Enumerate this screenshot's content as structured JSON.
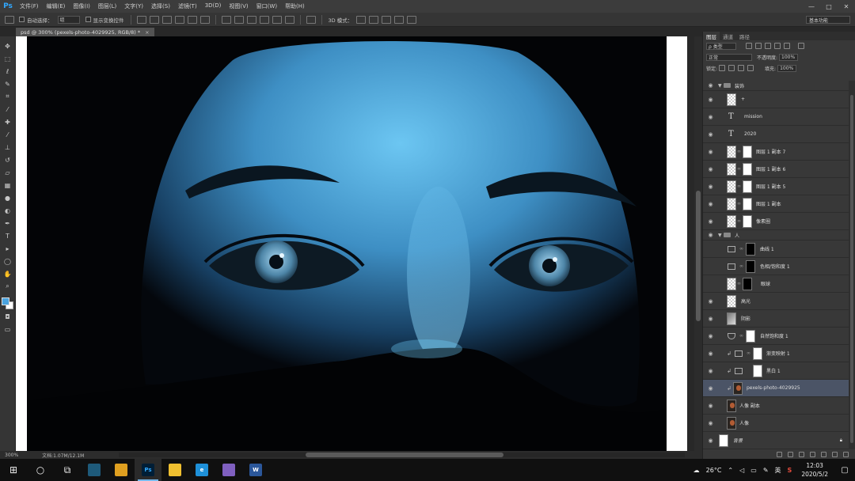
{
  "app": {
    "logo": "Ps"
  },
  "menu": [
    "文件(F)",
    "编辑(E)",
    "图像(I)",
    "图层(L)",
    "文字(Y)",
    "选择(S)",
    "滤镜(T)",
    "3D(D)",
    "视图(V)",
    "窗口(W)",
    "帮助(H)"
  ],
  "window_controls": {
    "minimize": "—",
    "maximize": "□",
    "close": "✕"
  },
  "options": {
    "auto_select_label": "自动选择：",
    "auto_select_value": "组",
    "show_transform_label": "显示变换控件",
    "mode_3d_label": "3D 模式：",
    "workspace": "基本功能"
  },
  "document": {
    "tab_title": "psd @ 300% (pexels-photo-4029925, RGB/8) *",
    "tab_close": "×",
    "zoom": "300%",
    "doc_info": "文档:1.07M/12.1M"
  },
  "tools": [
    "move",
    "marquee",
    "lasso",
    "quick-select",
    "crop",
    "eyedropper",
    "healing",
    "brush",
    "stamp",
    "history-brush",
    "eraser",
    "gradient",
    "blur",
    "dodge",
    "pen",
    "type",
    "path-select",
    "shape",
    "hand",
    "zoom"
  ],
  "colors": {
    "foreground": "#4aa3df",
    "background": "#ffffff",
    "selected_layer": "#4b5466",
    "accent": "#31a8ff"
  },
  "layers_panel": {
    "tabs": [
      "图层",
      "通道",
      "路径"
    ],
    "filter_label": "ρ 类型",
    "blend_mode": "正常",
    "opacity_label": "不透明度:",
    "opacity_value": "100%",
    "lock_label": "锁定:",
    "fill_label": "填充:",
    "fill_value": "100%",
    "layers": [
      {
        "name": "装饰",
        "kind": "group",
        "visible": true
      },
      {
        "name": "+",
        "kind": "pixel",
        "visible": true,
        "indent": 1
      },
      {
        "name": "mission",
        "kind": "text",
        "visible": true,
        "indent": 1
      },
      {
        "name": "2020",
        "kind": "text",
        "visible": true,
        "indent": 1
      },
      {
        "name": "图层 1 副本 7",
        "kind": "masked",
        "visible": true,
        "indent": 1
      },
      {
        "name": "图层 1 副本 6",
        "kind": "masked",
        "visible": true,
        "indent": 1
      },
      {
        "name": "图层 1 副本 5",
        "kind": "masked",
        "visible": true,
        "indent": 1
      },
      {
        "name": "图层 1 副本",
        "kind": "masked",
        "visible": true,
        "indent": 1
      },
      {
        "name": "像素圈",
        "kind": "masked",
        "visible": true,
        "indent": 1
      },
      {
        "name": "人",
        "kind": "group",
        "visible": true
      },
      {
        "name": "曲线 1",
        "kind": "adjust-black",
        "visible": false,
        "indent": 1
      },
      {
        "name": "色相/饱和度 1",
        "kind": "adjust-black",
        "visible": false,
        "indent": 1
      },
      {
        "name": "眼球",
        "kind": "masked-dark",
        "visible": false,
        "indent": 1
      },
      {
        "name": "高光",
        "kind": "pixel",
        "visible": true,
        "indent": 1
      },
      {
        "name": "阴影",
        "kind": "shadow",
        "visible": true,
        "indent": 1
      },
      {
        "name": "自然饱和度 1",
        "kind": "adjust",
        "visible": true,
        "indent": 1
      },
      {
        "name": "渐变映射 1",
        "kind": "adjust-clip",
        "visible": true,
        "indent": 1
      },
      {
        "name": "黑白 1",
        "kind": "adjust-clip-nochain",
        "visible": true,
        "indent": 1
      },
      {
        "name": "pexels-photo-4029925",
        "kind": "photo",
        "visible": true,
        "indent": 1,
        "selected": true
      },
      {
        "name": "人像 副本",
        "kind": "photo-plain",
        "visible": true,
        "indent": 1
      },
      {
        "name": "人像",
        "kind": "photo-plain",
        "visible": true,
        "indent": 1
      },
      {
        "name": "背景",
        "kind": "background",
        "visible": true
      }
    ]
  },
  "taskbar": {
    "weather": "26°C",
    "ime": "英",
    "time": "12:03",
    "date": "2020/5/2",
    "apps": [
      {
        "name": "screen-tool",
        "label": "",
        "color": "#1e5a7a"
      },
      {
        "name": "app-yellow",
        "label": "",
        "color": "#e0a020"
      },
      {
        "name": "photoshop",
        "label": "Ps",
        "color": "#001e36",
        "active": true
      },
      {
        "name": "file-explorer",
        "label": "",
        "color": "#f0c030"
      },
      {
        "name": "edge",
        "label": "e",
        "color": "#1e90d8"
      },
      {
        "name": "game",
        "label": "",
        "color": "#8060c0"
      },
      {
        "name": "word",
        "label": "W",
        "color": "#2b579a"
      }
    ]
  }
}
